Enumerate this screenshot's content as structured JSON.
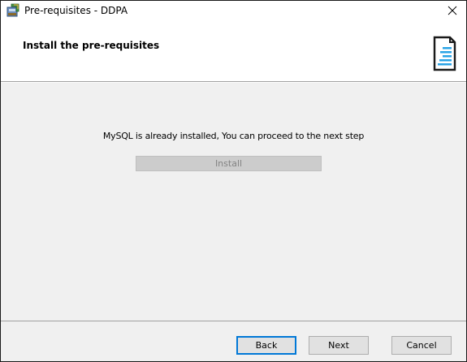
{
  "window": {
    "title": "Pre-requisites - DDPA",
    "close_glyph": "✕"
  },
  "header": {
    "title": "Install the pre-requisites",
    "logo_icon": "document-lines-icon",
    "logo_accent": "#29a3e6"
  },
  "body": {
    "message": "MySQL is already installed, You can proceed to the next step",
    "install_label": "Install",
    "install_enabled": false
  },
  "footer": {
    "back_label": "Back",
    "next_label": "Next",
    "cancel_label": "Cancel"
  },
  "colors": {
    "accent": "#0078d7",
    "window_bg": "#f0f0f0"
  }
}
